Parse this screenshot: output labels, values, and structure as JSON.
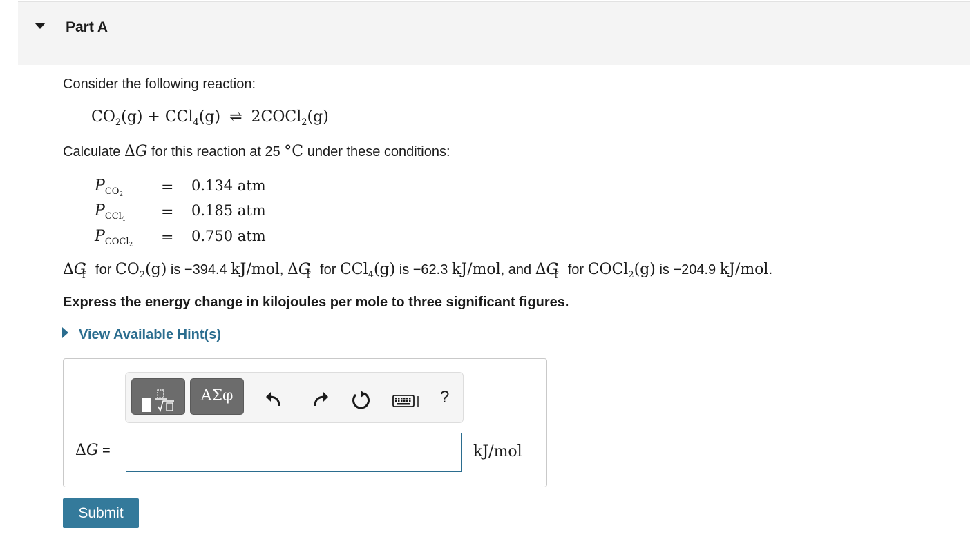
{
  "part": {
    "title": "Part A"
  },
  "question": {
    "intro": "Consider the following reaction:",
    "reaction": {
      "reactant1": "CO",
      "reactant1_sub": "2",
      "reactant2": "CCl",
      "reactant2_sub": "4",
      "product_coef": "2COCl",
      "product_sub": "2",
      "phase": "(g)",
      "plus": "+",
      "arrow": "⇌"
    },
    "calc_prefix": "Calculate ",
    "calc_delta": "Δ",
    "calc_g": "G",
    "calc_mid": " for this reaction at 25 ",
    "calc_deg": "°C",
    "calc_suffix": " under these conditions:",
    "conditions": [
      {
        "symbol": "P",
        "sub": "CO",
        "subsub": "2",
        "eq": "=",
        "value": "0.134 atm"
      },
      {
        "symbol": "P",
        "sub": "CCl",
        "subsub": "4",
        "eq": "=",
        "value": "0.185 atm"
      },
      {
        "symbol": "P",
        "sub": "COCl",
        "subsub": "2",
        "eq": "=",
        "value": "0.750 atm"
      }
    ],
    "formation": {
      "delta": "Δ",
      "g": "G",
      "sup": "∘",
      "sub": "f",
      "for": " for ",
      "is": " is ",
      "comma": ", ",
      "and": ", and ",
      "period": ".",
      "s1_species": "CO",
      "s1_sub": "2",
      "s1_value": "−394.4",
      "s1_unit": "kJ/mol",
      "s2_species": "CCl",
      "s2_sub": "4",
      "s2_value": "−62.3",
      "s2_unit": "kJ/mol",
      "s3_species": "COCl",
      "s3_sub": "2",
      "s3_value": "−204.9",
      "s3_unit": "kJ/mol",
      "phase": "(g)"
    },
    "instruction": "Express the energy change in kilojoules per mole to three significant figures."
  },
  "hint": {
    "label": "View Available Hint(s)"
  },
  "toolbar": {
    "templates_icon": "fraction-root-templates-icon",
    "symbols_label": "ΑΣφ",
    "undo_icon": "undo-icon",
    "redo_icon": "redo-icon",
    "reset_icon": "reset-icon",
    "keyboard_icon": "keyboard-icon",
    "help_label": "?"
  },
  "answer": {
    "label_delta": "Δ",
    "label_g": "G",
    "label_eq": " =",
    "value": "",
    "unit": "kJ/mol"
  },
  "submit": {
    "label": "Submit"
  },
  "colors": {
    "accent": "#2b6d8f",
    "submit_bg": "#347a9b",
    "header_bg": "#f4f4f4",
    "toolbar_button": "#6c6c6c"
  }
}
